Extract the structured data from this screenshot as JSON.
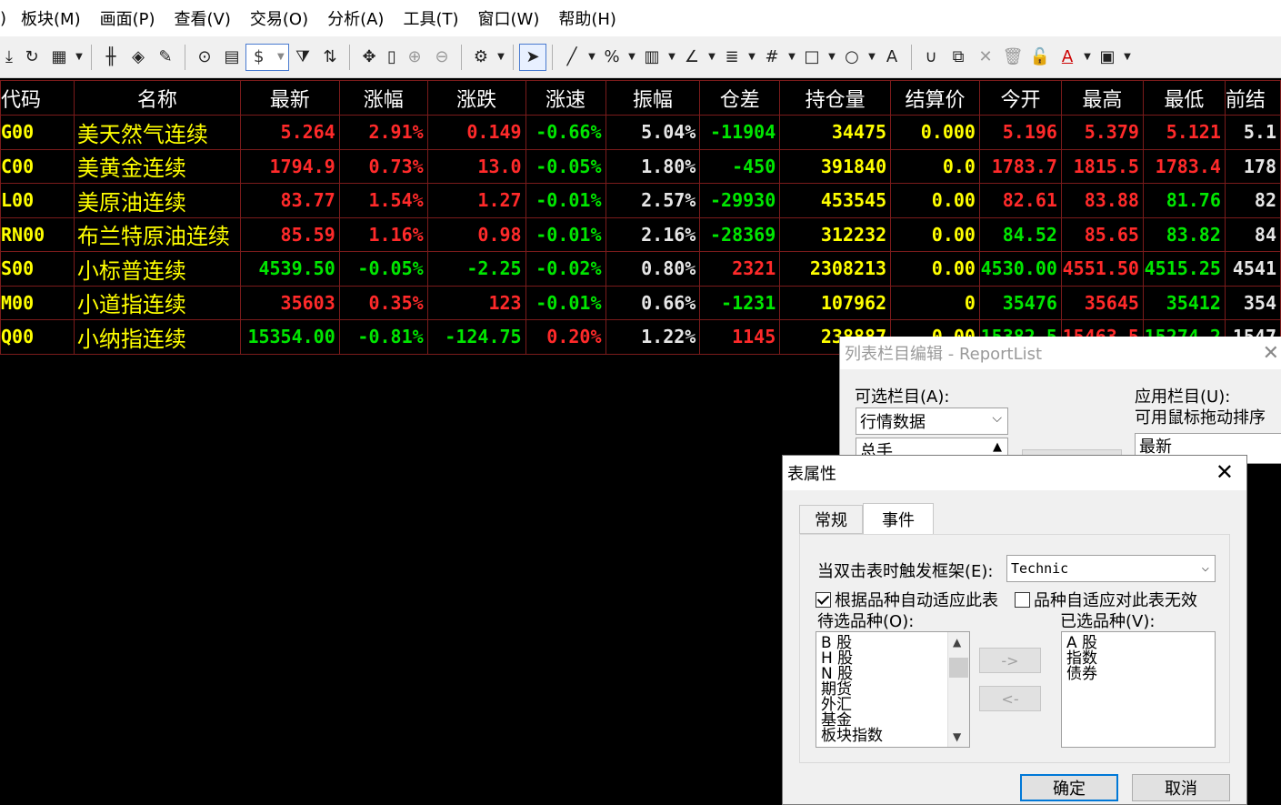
{
  "menu": [
    "板块(M)",
    "画面(P)",
    "查看(V)",
    "交易(O)",
    "分析(A)",
    "工具(T)",
    "窗口(W)",
    "帮助(H)"
  ],
  "menu_first_fragment": ")",
  "toolbar": {
    "dollar_label": "$",
    "icons": [
      "download-icon",
      "refresh-icon",
      "grid-icon",
      "candlestick-icon",
      "diamond-icon",
      "edit-icon",
      "play-icon",
      "doc-icon",
      "dollar-icon",
      "filter-icon",
      "sort-icon",
      "move-icon",
      "column-icon",
      "zoom-in-icon",
      "zoom-out-icon",
      "settings-icon",
      "pointer-icon",
      "line-icon",
      "percent-icon",
      "bars-icon",
      "angle-icon",
      "channel-icon",
      "hash-icon",
      "rectangle-icon",
      "circle-icon",
      "text-icon",
      "magnet-icon",
      "copy-icon",
      "delete-icon",
      "trash-icon",
      "lock-icon",
      "color-icon",
      "save-icon"
    ]
  },
  "table": {
    "headers": [
      "代码",
      "名称",
      "最新",
      "涨幅",
      "涨跌",
      "涨速",
      "振幅",
      "仓差",
      "持仓量",
      "结算价",
      "今开",
      "最高",
      "最低",
      "前结"
    ],
    "rows": [
      {
        "code": "G00",
        "name": "美天然气连续",
        "last": "5.264",
        "chg_pct": "2.91%",
        "chg": "0.149",
        "speed": "-0.66%",
        "amp": "5.04%",
        "oi_diff": "-11904",
        "oi": "34475",
        "settle": "0.000",
        "open": "5.196",
        "high": "5.379",
        "low": "5.121",
        "prev": "5.1"
      },
      {
        "code": "C00",
        "name": "美黄金连续",
        "last": "1794.9",
        "chg_pct": "0.73%",
        "chg": "13.0",
        "speed": "-0.05%",
        "amp": "1.80%",
        "oi_diff": "-450",
        "oi": "391840",
        "settle": "0.0",
        "open": "1783.7",
        "high": "1815.5",
        "low": "1783.4",
        "prev": "178"
      },
      {
        "code": "L00",
        "name": "美原油连续",
        "last": "83.77",
        "chg_pct": "1.54%",
        "chg": "1.27",
        "speed": "-0.01%",
        "amp": "2.57%",
        "oi_diff": "-29930",
        "oi": "453545",
        "settle": "0.00",
        "open": "82.61",
        "high": "83.88",
        "low": "81.76",
        "prev": "82"
      },
      {
        "code": "RN00",
        "name": "布兰特原油连续",
        "last": "85.59",
        "chg_pct": "1.16%",
        "chg": "0.98",
        "speed": "-0.01%",
        "amp": "2.16%",
        "oi_diff": "-28369",
        "oi": "312232",
        "settle": "0.00",
        "open": "84.52",
        "high": "85.65",
        "low": "83.82",
        "prev": "84"
      },
      {
        "code": "S00",
        "name": "小标普连续",
        "last": "4539.50",
        "chg_pct": "-0.05%",
        "chg": "-2.25",
        "speed": "-0.02%",
        "amp": "0.80%",
        "oi_diff": "2321",
        "oi": "2308213",
        "settle": "0.00",
        "open": "4530.00",
        "high": "4551.50",
        "low": "4515.25",
        "prev": "4541"
      },
      {
        "code": "M00",
        "name": "小道指连续",
        "last": "35603",
        "chg_pct": "0.35%",
        "chg": "123",
        "speed": "-0.01%",
        "amp": "0.66%",
        "oi_diff": "-1231",
        "oi": "107962",
        "settle": "0",
        "open": "35476",
        "high": "35645",
        "low": "35412",
        "prev": "354"
      },
      {
        "code": "Q00",
        "name": "小纳指连续",
        "last": "15354.00",
        "chg_pct": "-0.81%",
        "chg": "-124.75",
        "speed": "0.20%",
        "amp": "1.22%",
        "oi_diff": "1145",
        "oi": "238887",
        "settle": "0.00",
        "open": "15382.5",
        "high": "15463.5",
        "low": "15274.2",
        "prev": "1547"
      }
    ]
  },
  "report_dialog": {
    "title": "列表栏目编辑 - ReportList",
    "available_label": "可选栏目(A):",
    "available_combo": "行情数据",
    "available_first_item": "总手",
    "applied_label": "应用栏目(U):",
    "applied_hint": "可用鼠标拖动排序",
    "applied_first_item": "最新"
  },
  "prop_dialog": {
    "title": "表属性",
    "tabs": [
      "常规",
      "事件"
    ],
    "active_tab": "事件",
    "trigger_label": "当双击表时触发框架(E):",
    "trigger_value": "Technic",
    "auto_adapt_label": "根据品种自动适应此表",
    "auto_adapt_checked": true,
    "invalid_label": "品种自适应对此表无效",
    "invalid_checked": false,
    "pending_label": "待选品种(O):",
    "pending_items": [
      "B 股",
      "H 股",
      "N 股",
      "期货",
      "外汇",
      "基金",
      "板块指数"
    ],
    "selected_label": "已选品种(V):",
    "selected_items": [
      "A 股",
      "指数",
      "债券"
    ],
    "move_right": "->",
    "move_left": "<-",
    "ok": "确定",
    "cancel": "取消"
  }
}
